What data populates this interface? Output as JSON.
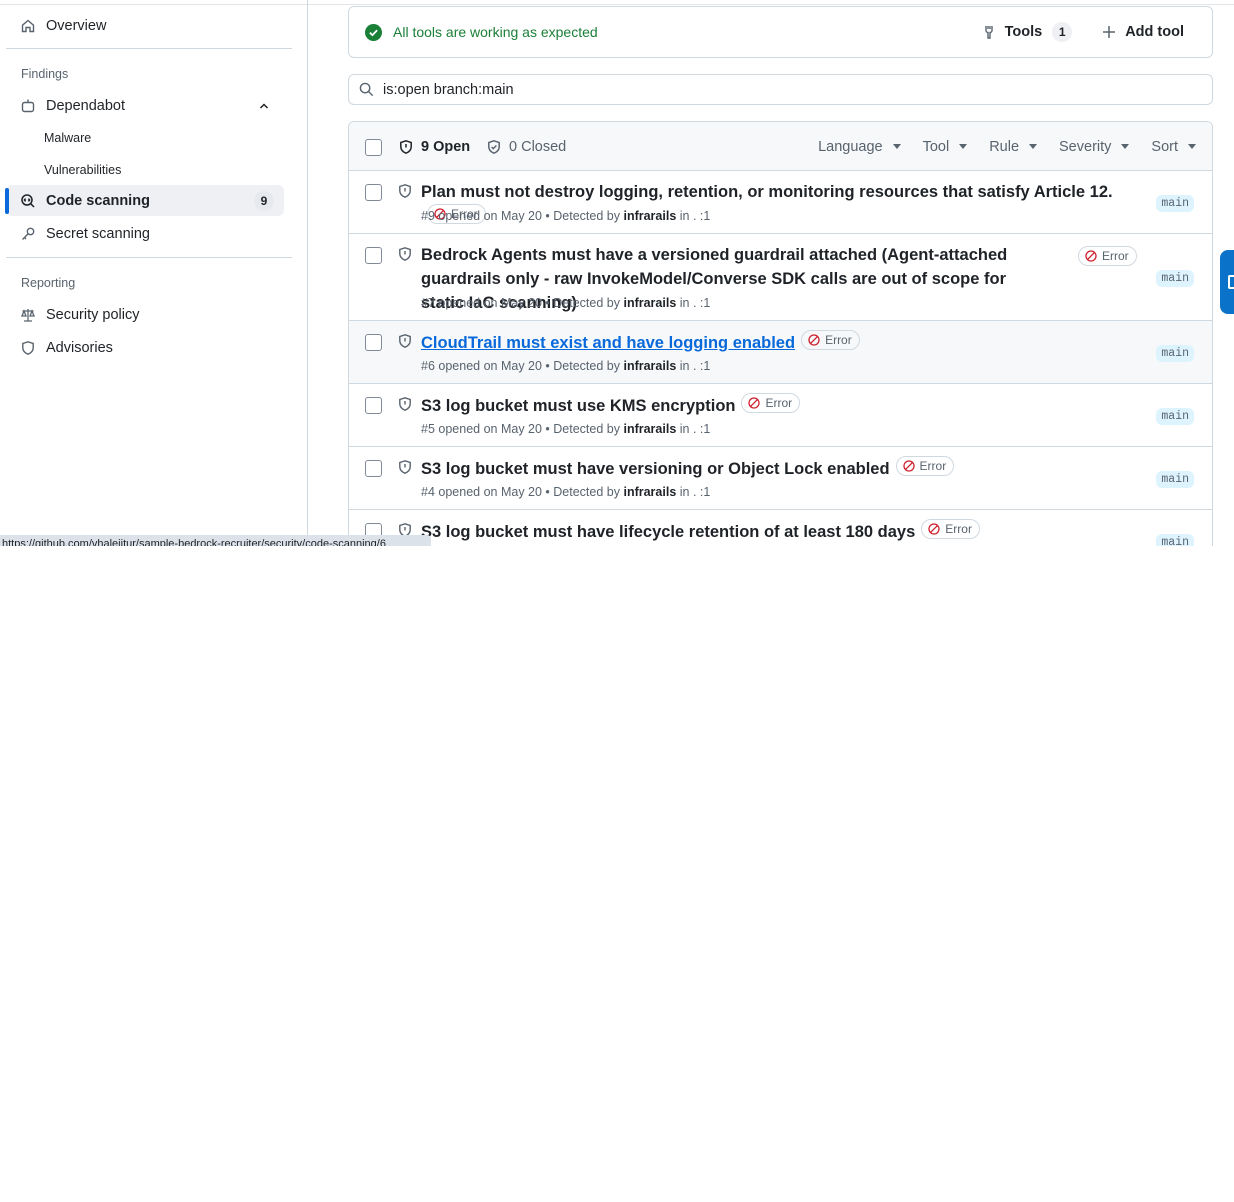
{
  "sidebar": {
    "overview_label": "Overview",
    "findings_label": "Findings",
    "dependabot_label": "Dependabot",
    "malware_label": "Malware",
    "vulnerabilities_label": "Vulnerabilities",
    "code_scanning_label": "Code scanning",
    "code_scanning_count": "9",
    "secret_scanning_label": "Secret scanning",
    "reporting_label": "Reporting",
    "security_policy_label": "Security policy",
    "advisories_label": "Advisories"
  },
  "tools": {
    "status": "All tools are working as expected",
    "tools_label": "Tools",
    "tools_count": "1",
    "add_tool_label": "Add tool"
  },
  "search": {
    "value": "is:open branch:main"
  },
  "list": {
    "open_label": "9 Open",
    "closed_label": "0 Closed",
    "filters": [
      "Language",
      "Tool",
      "Rule",
      "Severity",
      "Sort"
    ],
    "rows": [
      {
        "title": "Plan must not destroy logging, retention, or monitoring resources that satisfy Article 12.",
        "severity": "Error",
        "number": "#9",
        "opened": "opened on May 20 • Detected by",
        "tool": "infrarails",
        "location": "in . :1",
        "branch": "main"
      },
      {
        "title": "Bedrock Agents must have a versioned guardrail attached (Agent-attached guardrails only - raw InvokeModel/Converse SDK calls are out of scope for static IaC scanning)",
        "severity": "Error",
        "number": "#7",
        "opened": "opened on May 20 • Detected by",
        "tool": "infrarails",
        "location": "in . :1",
        "branch": "main"
      },
      {
        "title": "CloudTrail must exist and have logging enabled",
        "severity": "Error",
        "number": "#6",
        "opened": "opened on May 20 • Detected by",
        "tool": "infrarails",
        "location": "in . :1",
        "branch": "main"
      },
      {
        "title": "S3 log bucket must use KMS encryption",
        "severity": "Error",
        "number": "#5",
        "opened": "opened on May 20 • Detected by",
        "tool": "infrarails",
        "location": "in . :1",
        "branch": "main"
      },
      {
        "title": "S3 log bucket must have versioning or Object Lock enabled",
        "severity": "Error",
        "number": "#4",
        "opened": "opened on May 20 • Detected by",
        "tool": "infrarails",
        "location": "in . :1",
        "branch": "main"
      },
      {
        "title": "S3 log bucket must have lifecycle retention of at least 180 days",
        "severity": "Error",
        "branch": "main"
      }
    ]
  },
  "status_bar": {
    "url": "https://github.com/vhalejitur/sample-bedrock-recruiter/security/code-scanning/6"
  },
  "colors": {
    "accent": "#0969da",
    "success": "#1a7f37",
    "danger": "#cf222e",
    "muted": "#59636e"
  }
}
